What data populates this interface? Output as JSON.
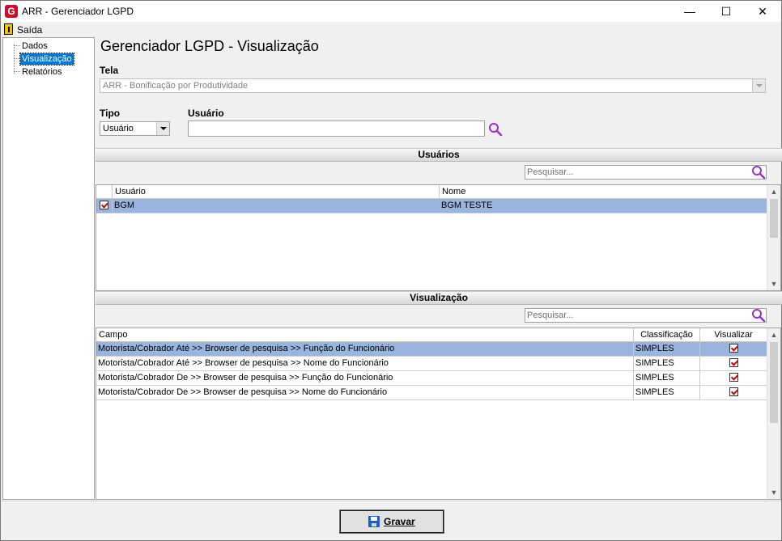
{
  "window": {
    "title": "ARR - Gerenciador LGPD",
    "logo_letter": "G",
    "minimize": "—",
    "maximize": "☐",
    "close": "✕"
  },
  "menu": {
    "exit_label": "Saída"
  },
  "sidebar": {
    "items": [
      {
        "label": "Dados"
      },
      {
        "label": "Visualização"
      },
      {
        "label": "Relatórios"
      }
    ]
  },
  "page": {
    "title": "Gerenciador LGPD - Visualização"
  },
  "tela": {
    "label": "Tela",
    "value": "ARR - Bonificação por Produtividade"
  },
  "tipo": {
    "label": "Tipo",
    "value": "Usuário"
  },
  "usuario": {
    "label": "Usuário",
    "value": ""
  },
  "users_section": {
    "title": "Usuários",
    "search_placeholder": "Pesquisar...",
    "columns": [
      "Usuário",
      "Nome"
    ],
    "rows": [
      {
        "checked": true,
        "usuario": "BGM",
        "nome": "BGM TESTE",
        "selected": true
      }
    ]
  },
  "view_section": {
    "title": "Visualização",
    "search_placeholder": "Pesquisar...",
    "columns": [
      "Campo",
      "Classificação",
      "Visualizar"
    ],
    "rows": [
      {
        "campo": "Motorista/Cobrador Até >> Browser de pesquisa >> Função do Funcionário",
        "classificacao": "SIMPLES",
        "visualizar": true,
        "selected": true
      },
      {
        "campo": "Motorista/Cobrador Até >> Browser de pesquisa >> Nome do Funcionário",
        "classificacao": "SIMPLES",
        "visualizar": true
      },
      {
        "campo": "Motorista/Cobrador De >> Browser de pesquisa >> Função do Funcionário",
        "classificacao": "SIMPLES",
        "visualizar": true
      },
      {
        "campo": "Motorista/Cobrador De >> Browser de pesquisa >> Nome do Funcionário",
        "classificacao": "SIMPLES",
        "visualizar": true
      }
    ]
  },
  "footer": {
    "save_label": "Gravar"
  },
  "colors": {
    "selection": "#9ab4e0",
    "tree_selection": "#0078d7",
    "search_icon": "#9b30c8",
    "check": "#d00000"
  }
}
